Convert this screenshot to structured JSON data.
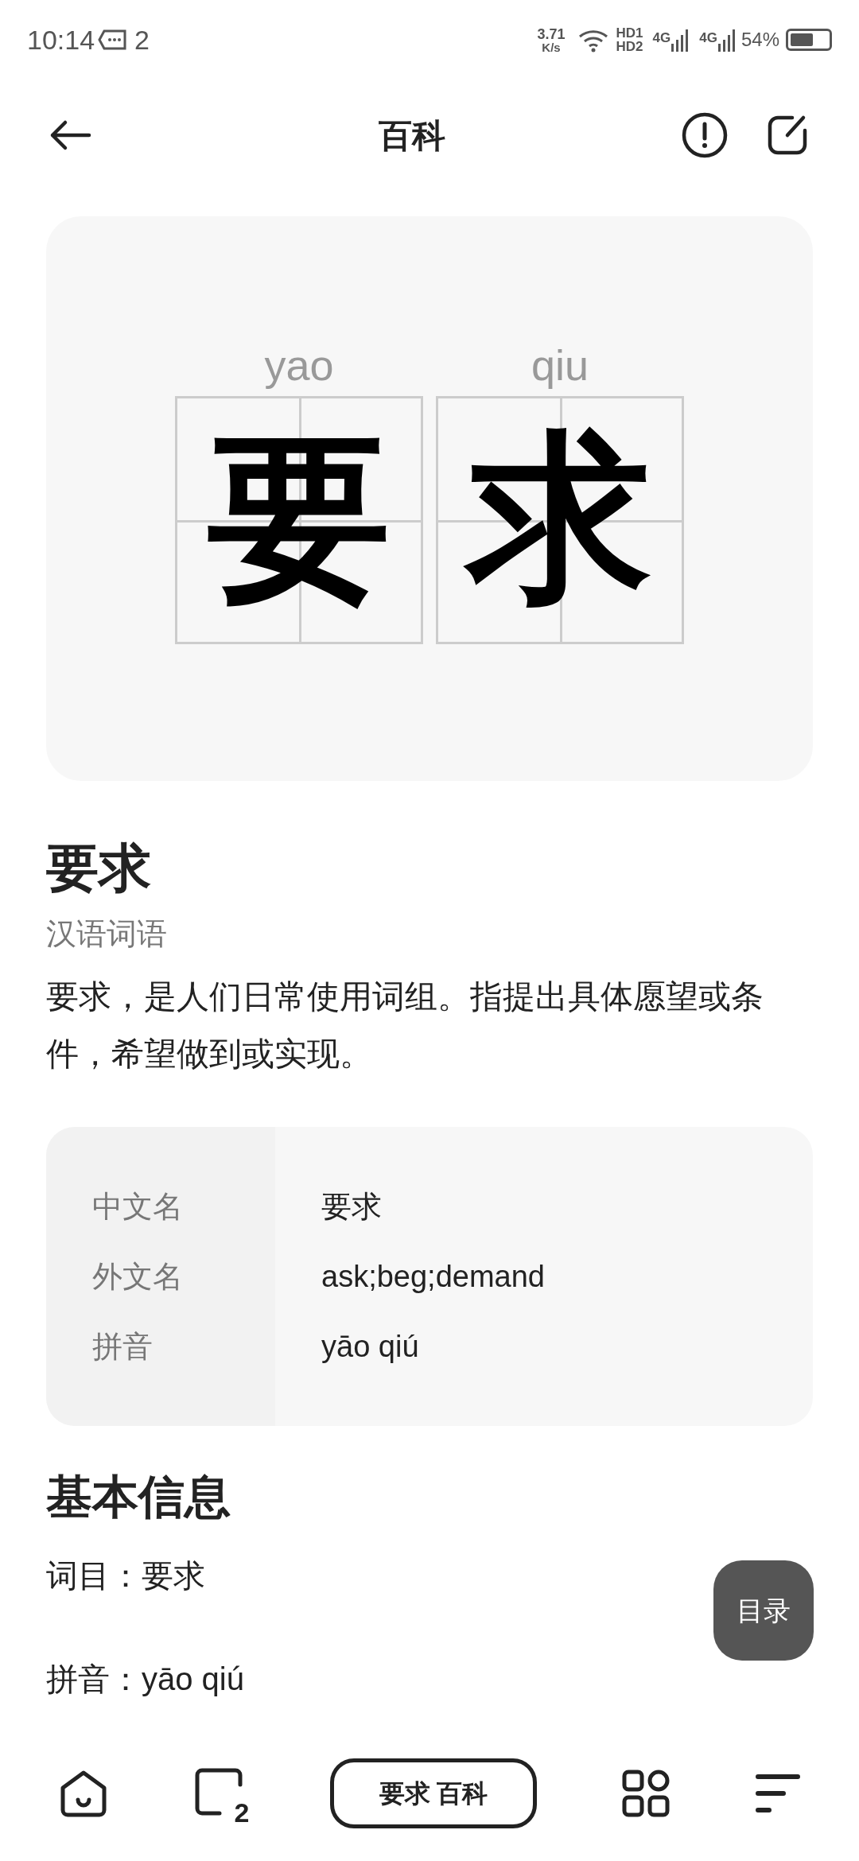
{
  "status_bar": {
    "time": "10:14",
    "notification_count": "2",
    "net_speed": "3.71",
    "net_unit": "K/s",
    "sim1": "HD1",
    "sim2": "HD2",
    "net1": "4G",
    "net2": "4G",
    "battery": "54%"
  },
  "header": {
    "title": "百科"
  },
  "character_card": {
    "characters": [
      {
        "pinyin": "yao",
        "char": "要"
      },
      {
        "pinyin": "qiu",
        "char": "求"
      }
    ]
  },
  "entry": {
    "title": "要求",
    "category": "汉语词语",
    "summary": "要求，是人们日常使用词组。指提出具体愿望或条件，希望做到或实现。"
  },
  "info_table": [
    {
      "label": "中文名",
      "value": "要求"
    },
    {
      "label": "外文名",
      "value": "ask;beg;demand"
    },
    {
      "label": "拼音",
      "value": "yāo qiú"
    }
  ],
  "basic_info": {
    "heading": "基本信息",
    "lines": [
      "词目：要求",
      "拼音：yāo qiú"
    ]
  },
  "toc_button": "目录",
  "bottom_bar": {
    "tab_count": "2",
    "search_text": "要求 百科"
  }
}
